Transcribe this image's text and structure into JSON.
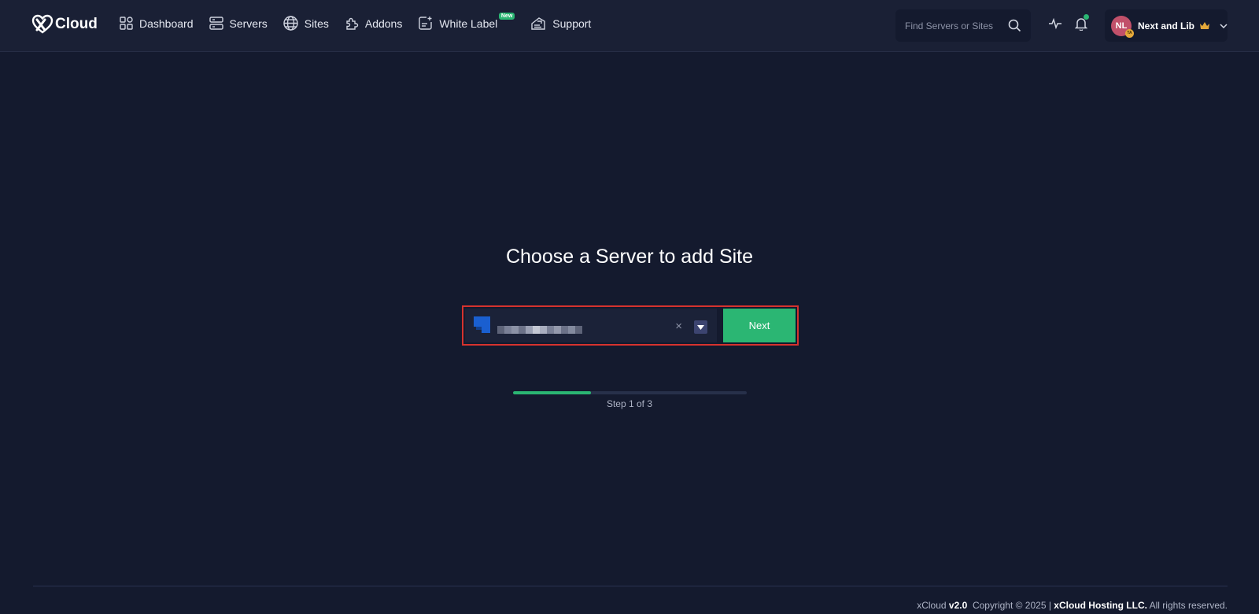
{
  "app": {
    "logo_text": "Cloud"
  },
  "nav": {
    "items": [
      {
        "label": "Dashboard",
        "icon": "dashboard-icon"
      },
      {
        "label": "Servers",
        "icon": "servers-icon"
      },
      {
        "label": "Sites",
        "icon": "globe-icon"
      },
      {
        "label": "Addons",
        "icon": "puzzle-icon"
      },
      {
        "label": "White Label",
        "icon": "white-label-icon",
        "badge": "New"
      },
      {
        "label": "Support",
        "icon": "support-icon"
      }
    ]
  },
  "search": {
    "placeholder": "Find Servers or Sites"
  },
  "user": {
    "initials": "NL",
    "mini_badge": "TA",
    "name": "Next and Lib"
  },
  "main": {
    "title": "Choose a Server to add Site",
    "server_select": {
      "clear_symbol": "×"
    },
    "next_label": "Next",
    "progress": {
      "fraction": 0.333,
      "step_text": "Step 1 of 3"
    }
  },
  "footer": {
    "app_name": "xCloud",
    "version": "v2.0",
    "copyright": "Copyright © 2025 |",
    "company": "xCloud Hosting LLC.",
    "rights": "All rights reserved."
  },
  "colors": {
    "background": "#141a2e",
    "header": "#1a2035",
    "accent_green": "#2bb673",
    "highlight_red": "#d6332e"
  }
}
